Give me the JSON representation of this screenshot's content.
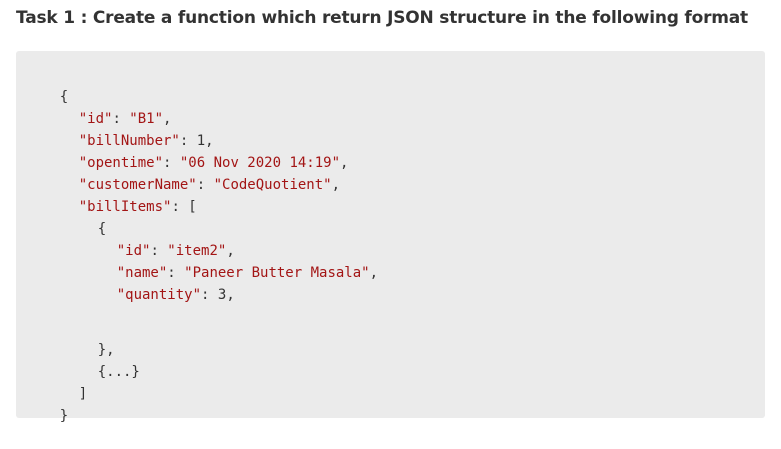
{
  "heading": {
    "text": "Task 1 : Create a function which return JSON structure in the following format"
  },
  "code": {
    "open_brace": "{",
    "id_key": "\"id\"",
    "id_value": "\"B1\"",
    "billNumber_key": "\"billNumber\"",
    "billNumber_value": "1",
    "opentime_key": "\"opentime\"",
    "opentime_value": "\"06 Nov 2020 14:19\"",
    "customerName_key": "\"customerName\"",
    "customerName_value": "\"CodeQuotient\"",
    "billItems_key": "\"billItems\"",
    "array_open": "[",
    "item_open": "{",
    "item_id_key": "\"id\"",
    "item_id_value": "\"item2\"",
    "item_name_key": "\"name\"",
    "item_name_value": "\"Paneer Butter Masala\"",
    "item_quantity_key": "\"quantity\"",
    "item_quantity_value": "3",
    "item_close": "},",
    "ellipsis_item": "{...}",
    "array_close": "]",
    "close_brace": "}",
    "colon": ": ",
    "comma": ","
  },
  "colors": {
    "code_background": "#ebebeb",
    "string_color": "#a31515",
    "text_color": "#333333"
  }
}
